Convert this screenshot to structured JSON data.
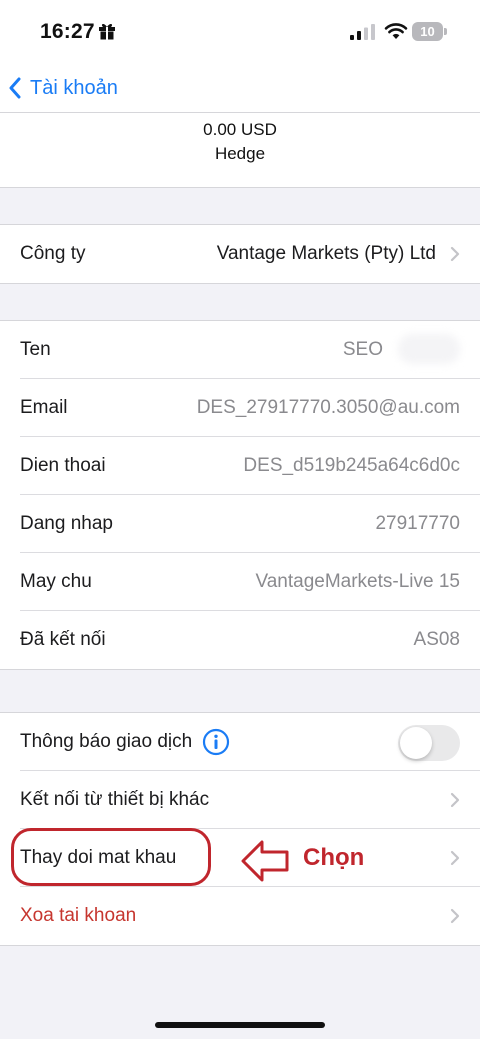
{
  "status_bar": {
    "time": "16:27",
    "battery": "10"
  },
  "nav": {
    "back_label": "Tài khoản"
  },
  "account_header": {
    "balance": "0.00 USD",
    "type": "Hedge"
  },
  "company": {
    "label": "Công ty",
    "value": "Vantage Markets (Pty) Ltd"
  },
  "details": [
    {
      "label": "Ten",
      "value": "SEO"
    },
    {
      "label": "Email",
      "value": "DES_27917770.3050@au.com"
    },
    {
      "label": "Dien thoai",
      "value": "DES_d519b245a64c6d0c"
    },
    {
      "label": "Dang nhap",
      "value": "27917770"
    },
    {
      "label": "May chu",
      "value": "VantageMarkets-Live 15"
    },
    {
      "label": "Đã kết nối",
      "value": "AS08"
    }
  ],
  "settings": {
    "trade_notifications": {
      "label": "Thông báo giao dịch",
      "enabled": false
    },
    "connect_other_device": {
      "label": "Kết nối từ thiết bị khác"
    },
    "change_password": {
      "label": "Thay doi mat khau"
    },
    "delete_account": {
      "label": "Xoa tai khoan"
    }
  },
  "annotation": {
    "text": "Chọn",
    "color": "#c0262d"
  },
  "colors": {
    "accent": "#1a7cf5",
    "destructive": "#c6362f",
    "background": "#f2f2f7"
  }
}
